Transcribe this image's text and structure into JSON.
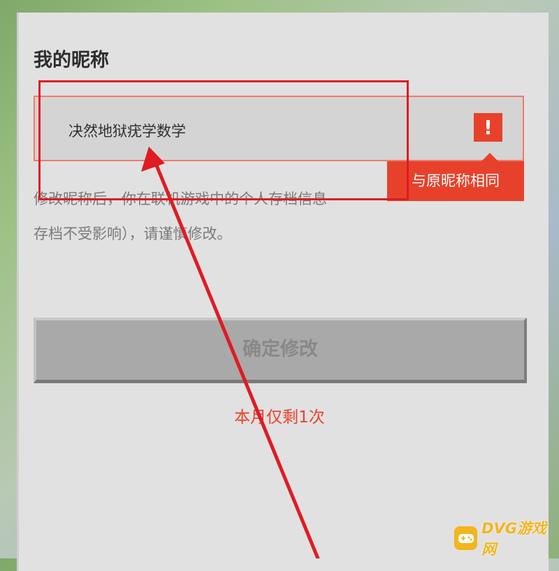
{
  "dialog": {
    "title": "我的昵称",
    "nickname_value": "决然地狱疣学数学",
    "warning_icon": "!",
    "tooltip": "与原昵称相同",
    "description": [
      "修改昵称后，你在联机游戏中的个人存档信息",
      "存档不受影响），请谨慎修改。"
    ],
    "confirm_label": "确定修改",
    "remaining_text": "本月仅剩1次"
  },
  "watermark": {
    "text": "DVG游戏网",
    "icon": "gamepad-icon"
  },
  "colors": {
    "accent_red": "#e8412b",
    "annotation_red": "#e01b22",
    "panel_bg": "#e1e1e1",
    "watermark": "#f3b51c"
  }
}
